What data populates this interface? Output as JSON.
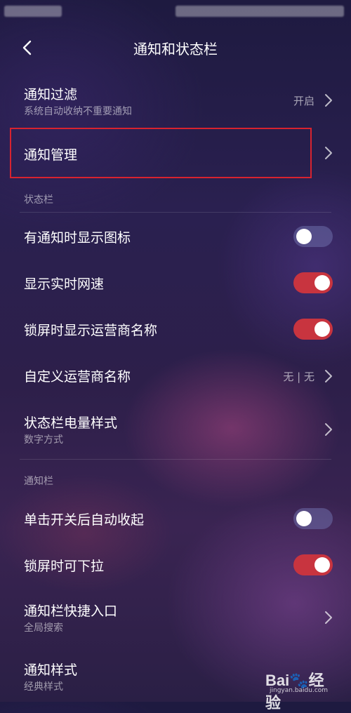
{
  "header": {
    "title": "通知和状态栏"
  },
  "rows": {
    "filter": {
      "title": "通知过滤",
      "sub": "系统自动收纳不重要通知",
      "value": "开启"
    },
    "manage": {
      "title": "通知管理"
    }
  },
  "statusbar_section": {
    "label": "状态栏",
    "show_icons": {
      "title": "有通知时显示图标",
      "on": false
    },
    "net_speed": {
      "title": "显示实时网速",
      "on": true
    },
    "lock_carrier": {
      "title": "锁屏时显示运营商名称",
      "on": true
    },
    "custom_carrier": {
      "title": "自定义运营商名称",
      "value": "无 | 无"
    },
    "battery_style": {
      "title": "状态栏电量样式",
      "sub": "数字方式"
    }
  },
  "notif_section": {
    "label": "通知栏",
    "auto_collapse": {
      "title": "单击开关后自动收起",
      "on": false
    },
    "lock_pulldown": {
      "title": "锁屏时可下拉",
      "on": true
    },
    "shortcut": {
      "title": "通知栏快捷入口",
      "sub": "全局搜索"
    },
    "style": {
      "title": "通知样式",
      "sub": "经典样式"
    }
  },
  "watermark": {
    "logo": "Bai🐾经验",
    "url": "jingyan.baidu.com"
  },
  "colors": {
    "accent_on": "#c8343f",
    "highlight": "#d8232f"
  }
}
